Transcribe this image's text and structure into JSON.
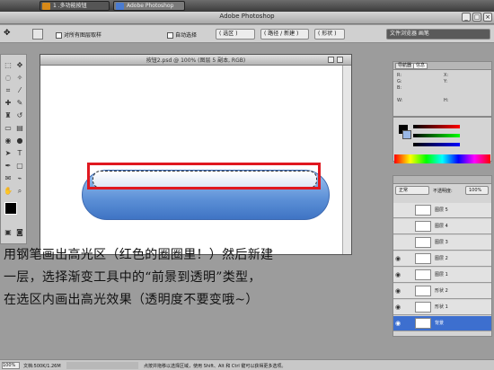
{
  "taskbar": {
    "tabs": [
      {
        "label": "1 .多功能按钮"
      },
      {
        "label": "Adobe Photoshop"
      }
    ]
  },
  "app": {
    "title": "Adobe Photoshop"
  },
  "options_bar": {
    "check_all_layers": "对所有图层取样",
    "check_auto": "自动选择",
    "btn1": "( 选区 )",
    "btn2": "( 路径 / 新建 )",
    "btn3": "( 形状 )",
    "right_box": "文件浏览器 画笔"
  },
  "document": {
    "title": "按钮2.psd @ 100% (图层 5 副本, RGB)"
  },
  "caption": {
    "line1": "用钢笔画出高光区（红色的圈圈里！）然后新建",
    "line2": "一层，选择渐变工具中的“前景到透明”类型，",
    "line3": "在选区内画出高光效果（透明度不要变哦~）"
  },
  "nav_panel": {
    "tabs": [
      "导航器",
      "信息"
    ],
    "info": [
      "R:",
      "G:",
      "B:",
      "X:",
      "Y:",
      "W:",
      "H:"
    ]
  },
  "layers_panel": {
    "mode": "正常",
    "opacity_label": "不透明度:",
    "opacity": "100%",
    "layers": [
      "图层 5",
      "图层 4",
      "图层 3",
      "图层 2",
      "图层 1",
      "形状 2",
      "形状 1",
      "背景"
    ]
  },
  "status": {
    "zoom": "100%",
    "doc_info": "文档:500K/1.26M",
    "hint": "点按并拖移以选择区域，使用 Shift、Alt 和 Ctrl 键可以获得更多选项。"
  },
  "colors": {
    "accent_red": "#e01820",
    "pill_blue": "#5b8fd6",
    "selected_layer": "#3d6fcf"
  }
}
